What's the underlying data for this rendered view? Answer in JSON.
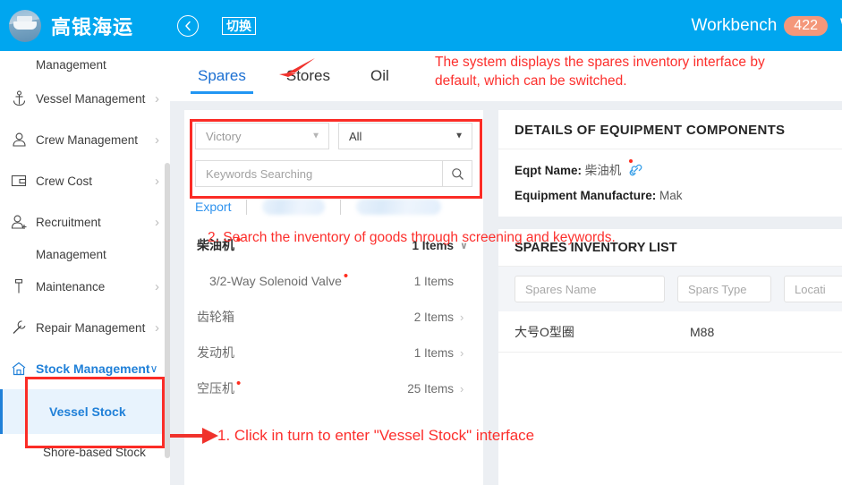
{
  "header": {
    "brand": "高银海运",
    "back_icon": "back-arrow-icon",
    "switch_label": "切换",
    "workbench_label": "Workbench",
    "workbench_badge": "422",
    "cut_off_text": "W"
  },
  "sidebar": {
    "items": [
      {
        "label": "Management",
        "wrapped_only": true
      },
      {
        "label": "Vessel Management",
        "icon": "anchor-icon",
        "chevron": "›"
      },
      {
        "label": "Crew Management",
        "icon": "person-icon",
        "chevron": "›"
      },
      {
        "label": "Crew Cost",
        "icon": "card-icon",
        "chevron": "›"
      },
      {
        "label": "Recruitment",
        "icon": "person-add-icon",
        "chevron": "›",
        "wrap": "Management"
      },
      {
        "label": "Maintenance",
        "icon": "hammer-icon",
        "chevron": "›"
      },
      {
        "label": "Repair Management",
        "icon": "wrench-icon",
        "chevron": "›"
      },
      {
        "label": "Stock Management",
        "icon": "home-icon",
        "chevron": "∨",
        "expanded": true
      }
    ],
    "sub_items": [
      {
        "label": "Vessel Stock",
        "active": true
      },
      {
        "label": "Shore-based Stock",
        "active": false
      }
    ]
  },
  "main": {
    "tabs": [
      {
        "label": "Spares",
        "active": true
      },
      {
        "label": "Stores",
        "active": false
      },
      {
        "label": "Oil",
        "active": false
      }
    ],
    "filters": {
      "vessel_select": "Victory",
      "category_select": "All",
      "search_placeholder": "Keywords Searching",
      "search_icon": "search-icon"
    },
    "actions": {
      "export_label": "Export",
      "hidden_action_1": "",
      "hidden_action_2": ""
    },
    "equipment_list": [
      {
        "name": "柴油机",
        "dot": true,
        "count": "1 Items",
        "arrow": "∨",
        "level": "head"
      },
      {
        "name": "3/2-Way Solenoid Valve",
        "dot": true,
        "count": "1 Items",
        "arrow": "",
        "level": "child"
      },
      {
        "name": "齿轮箱",
        "dot": false,
        "count": "2 Items",
        "arrow": "›",
        "level": "head"
      },
      {
        "name": "发动机",
        "dot": false,
        "count": "1 Items",
        "arrow": "›",
        "level": "head"
      },
      {
        "name": "空压机",
        "dot": true,
        "count": "25 Items",
        "arrow": "›",
        "level": "head"
      }
    ],
    "details": {
      "title": "DETAILS OF EQUIPMENT COMPONENTS",
      "eqpt_name_label": "Eqpt Name:",
      "eqpt_name_value": "柴油机",
      "eqpt_name_icon": "link-attachment-icon",
      "manufacture_label": "Equipment Manufacture:",
      "manufacture_value": "Mak"
    },
    "inventory": {
      "title": "SPARES INVENTORY LIST",
      "filters": [
        {
          "placeholder": "Spares Name"
        },
        {
          "placeholder": "Spars Type"
        },
        {
          "placeholder": "Locati"
        }
      ],
      "rows": [
        {
          "name": "大号O型圈",
          "type": "M88"
        }
      ]
    }
  },
  "annotations": [
    {
      "id": "note-tabs",
      "text": "The system displays the spares inventory interface by\ndefault, which can be switched."
    },
    {
      "id": "note-search",
      "text": "2. Search the inventory of goods through screening and keywords."
    },
    {
      "id": "note-sidebar",
      "text": "1. Click in turn to enter \"Vessel Stock\" interface"
    }
  ],
  "colors": {
    "header_blue": "#00a6ef",
    "accent_blue": "#2080d8",
    "annotation_red": "#fc2f2c",
    "badge_orange": "#f4977a"
  }
}
